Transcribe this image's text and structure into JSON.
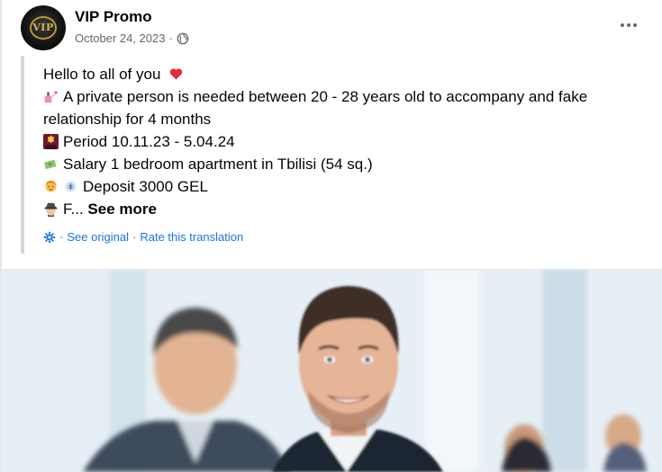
{
  "post": {
    "author": "VIP Promo",
    "avatar_text": "VIP",
    "date": "October 24, 2023",
    "date_separator": "·",
    "lines": [
      "Hello to all of you",
      "A private person is needed between 20 - 28 years old to accompany and fake relationship for 4 months",
      "Period 10.11.23 - 5.04.24",
      "Salary 1 bedroom apartment in Tbilisi (54 sq.)",
      "Deposit 3000 GEL",
      "F..."
    ],
    "see_more": "See more",
    "translation": {
      "separator": "·",
      "see_original": "See original",
      "rate": "Rate this translation"
    }
  },
  "icons": {
    "globe": "globe-icon",
    "more": "more-options-icon",
    "heart": "red-heart-emoji",
    "nails": "nail-polish-emoji",
    "fireworks": "fireworks-emoji",
    "money": "money-with-wings-emoji",
    "person": "person-emoji",
    "coin": "coin-emoji",
    "spy": "detective-emoji",
    "gear": "gear-icon"
  },
  "colors": {
    "link": "#1c74e4",
    "meta": "#65676b",
    "text": "#050505"
  }
}
